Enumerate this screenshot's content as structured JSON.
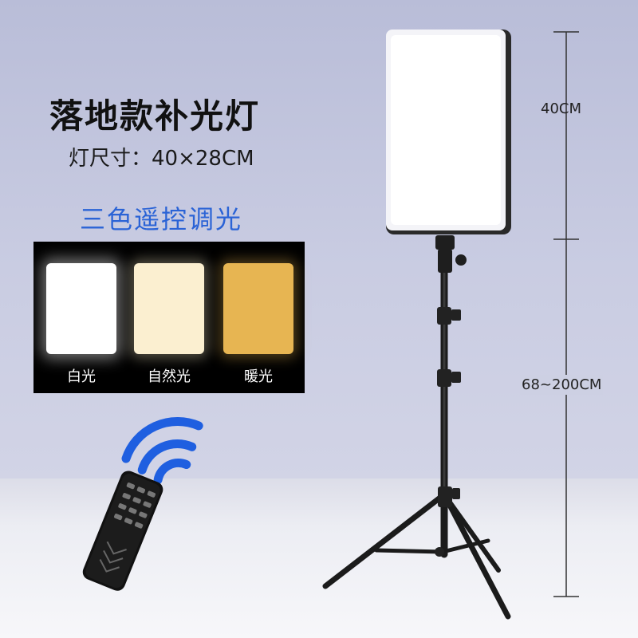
{
  "product": {
    "title": "落地款补光灯",
    "size_text": "灯尺寸：40×28CM",
    "subtitle": "三色遥控调光"
  },
  "swatches": [
    {
      "label": "白光",
      "color": "#ffffff"
    },
    {
      "label": "自然光",
      "color": "#fbefd0"
    },
    {
      "label": "暖光",
      "color": "#e7b552"
    }
  ],
  "dimensions": {
    "panel_height": "40CM",
    "stand_height": "68~200CM"
  },
  "colors": {
    "accent": "#2a63d6",
    "wifi_icon": "#1f5fe0"
  }
}
